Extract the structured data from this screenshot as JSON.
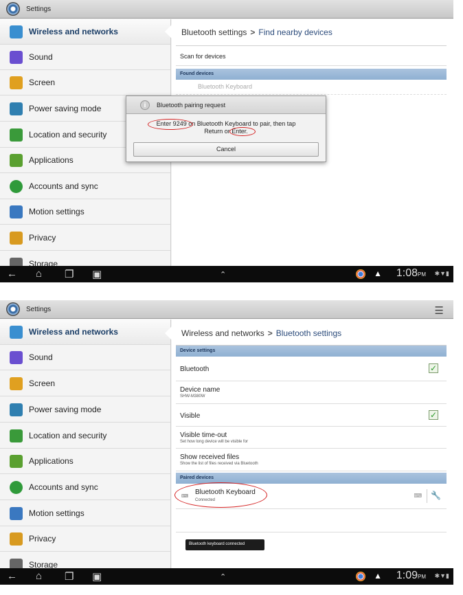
{
  "app": {
    "title": "Settings"
  },
  "sidebar": {
    "items": [
      {
        "label": "Wireless and networks",
        "icon": "wifi-icon",
        "color": "#3a8fd0"
      },
      {
        "label": "Sound",
        "icon": "speaker-icon",
        "color": "#6a4fd0"
      },
      {
        "label": "Screen",
        "icon": "brightness-icon",
        "color": "#e0a020"
      },
      {
        "label": "Power saving mode",
        "icon": "battery-icon",
        "color": "#2f7fb0"
      },
      {
        "label": "Location and security",
        "icon": "grid-lock-icon",
        "color": "#3a9a3a"
      },
      {
        "label": "Applications",
        "icon": "applications-icon",
        "color": "#5aa030"
      },
      {
        "label": "Accounts and sync",
        "icon": "sync-icon",
        "color": "#2f9a3a"
      },
      {
        "label": "Motion settings",
        "icon": "tablet-icon",
        "color": "#3a78c0"
      },
      {
        "label": "Privacy",
        "icon": "fence-icon",
        "color": "#d89a20"
      },
      {
        "label": "Storage",
        "icon": "storage-icon",
        "color": "#666666"
      }
    ]
  },
  "top": {
    "breadcrumb": {
      "parent": "Bluetooth settings",
      "separator": ">",
      "current": "Find nearby devices"
    },
    "scan_label": "Scan for devices",
    "found_header": "Found devices",
    "found_item": "Bluetooth Keyboard",
    "dialog": {
      "title": "Bluetooth pairing request",
      "message_line1": "Enter 9249 on Bluetooth Keyboard to pair, then tap",
      "message_line2": "Return or Enter.",
      "cancel_label": "Cancel"
    },
    "status": {
      "time": "1:08",
      "ampm": "PM"
    }
  },
  "bottom": {
    "breadcrumb": {
      "parent": "Wireless and networks",
      "separator": ">",
      "current": "Bluetooth settings"
    },
    "device_settings_header": "Device settings",
    "rows": {
      "bluetooth": {
        "title": "Bluetooth",
        "checked": true
      },
      "device_name": {
        "title": "Device name",
        "sub": "SHW-M380W"
      },
      "visible": {
        "title": "Visible",
        "checked": true
      },
      "visible_timeout": {
        "title": "Visible time-out",
        "sub": "Set how long device will be visible for"
      },
      "show_received": {
        "title": "Show received files",
        "sub": "Show the list of files received via Bluetooth"
      }
    },
    "paired_header": "Paired devices",
    "paired": {
      "name": "Bluetooth Keyboard",
      "status": "Connected"
    },
    "toast": "Bluetooth keyboard connected",
    "status": {
      "time": "1:09",
      "ampm": "PM"
    }
  }
}
